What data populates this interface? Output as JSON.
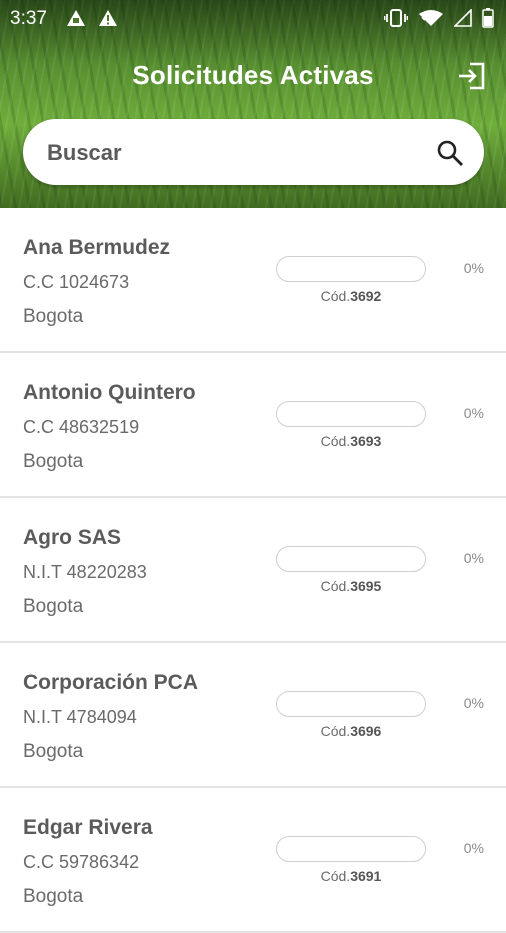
{
  "status_bar": {
    "time": "3:37",
    "left_icons": [
      "storage-warning-icon",
      "alert-icon"
    ],
    "right_icons": [
      "vibrate-icon",
      "wifi-icon",
      "signal-icon",
      "battery-icon"
    ]
  },
  "header": {
    "title": "Solicitudes Activas",
    "logout_icon": "logout-icon"
  },
  "search": {
    "placeholder": "Buscar",
    "icon": "search-icon"
  },
  "colors": {
    "header_green": "#5f9a34",
    "text_dark": "#5b5b5b",
    "text_light": "#6a6a6a",
    "divider": "#e3e3e3"
  },
  "requests": [
    {
      "name": "Ana Bermudez",
      "id_label": "C.C 1024673",
      "city": "Bogota",
      "code_prefix": "Cód.",
      "code": "3692",
      "progress": 0,
      "percent": "0%"
    },
    {
      "name": "Antonio Quintero",
      "id_label": "C.C 48632519",
      "city": "Bogota",
      "code_prefix": "Cód.",
      "code": "3693",
      "progress": 0,
      "percent": "0%"
    },
    {
      "name": "Agro SAS",
      "id_label": "N.I.T 48220283",
      "city": "Bogota",
      "code_prefix": "Cód.",
      "code": "3695",
      "progress": 0,
      "percent": "0%"
    },
    {
      "name": "Corporación PCA",
      "id_label": "N.I.T 4784094",
      "city": "Bogota",
      "code_prefix": "Cód.",
      "code": "3696",
      "progress": 0,
      "percent": "0%"
    },
    {
      "name": "Edgar Rivera",
      "id_label": "C.C 59786342",
      "city": "Bogota",
      "code_prefix": "Cód.",
      "code": "3691",
      "progress": 0,
      "percent": "0%"
    }
  ]
}
